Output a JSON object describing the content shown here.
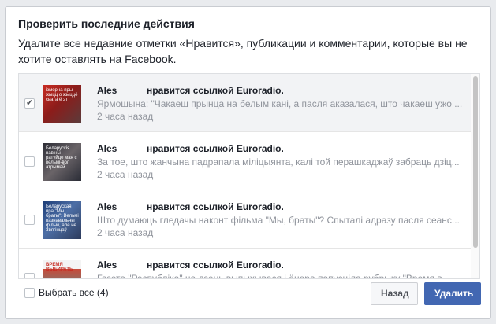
{
  "dialog": {
    "title": "Проверить последние действия",
    "description": "Удалите все недавние отметки «Нравится», публикации и комментарии, которые вы не хотите оставлять на Facebook."
  },
  "items": [
    {
      "checked": true,
      "author": "Ales",
      "action": "нравится ссылкой Euroradio.",
      "text": "Ярмошына: \"Чакаеш прынца на белым кані, а пасля аказалася, што чакаеш ужо ...",
      "time": "2 часа назад",
      "thumb_text": "ізмерна пры жыцц о жыццё свата ё эт"
    },
    {
      "checked": false,
      "author": "Ales",
      "action": "нравится ссылкой Euroradio.",
      "text": "За тое, што жанчына падрапала міліцыянта, калі той перашкаджаў забраць дзіц...",
      "time": "2 часа назад",
      "thumb_text": "Беларускія навіны ратуйце мая с вельмі-вол атрымай"
    },
    {
      "checked": false,
      "author": "Ales",
      "action": "нравится ссылкой Euroradio.",
      "text": "Што думаюць гледачы наконт фільма \"Мы, браты\"? Спыталі адразу пасля сеанс...",
      "time": "2 часа назад",
      "thumb_text": "Беларуская пра \"Мы браты\": Вельмі пазнавальны фільм, але не Звягінцаў"
    },
    {
      "checked": false,
      "author": "Ales",
      "action": "нравится ссылкой Euroradio.",
      "text": "Газета \"Рэспубліка\" на дзень выпыхывася і ёнора папусціла рубрыку \"Время в...",
      "time": "",
      "thumb_text": "ВРЕМЯ ВЫБИРАТЬ"
    }
  ],
  "footer": {
    "select_all": "Выбрать все (4)",
    "back_button": "Назад",
    "delete_button": "Удалить"
  }
}
